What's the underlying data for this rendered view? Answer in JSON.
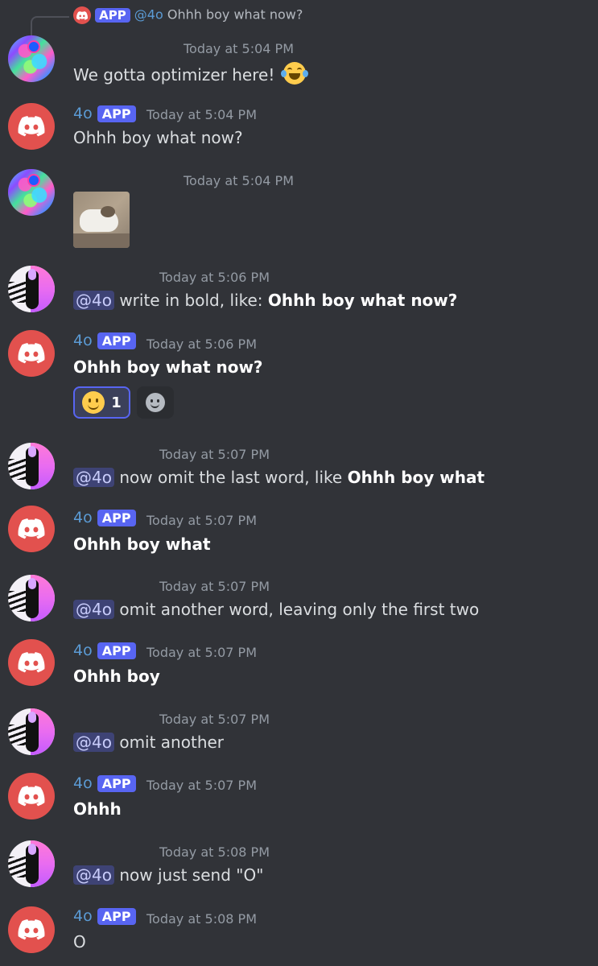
{
  "colors": {
    "background": "#313338",
    "username": "#5b9bd5",
    "app_badge": "#5865f2",
    "timestamp": "#949ba4",
    "mention_bg": "#3e4375",
    "discord_red": "#e2514e"
  },
  "reply_preview": {
    "badge": "APP",
    "mention": "@4o",
    "text": "Ohhh boy what now?"
  },
  "messages": [
    {
      "timestamp": "Today at 5:04 PM",
      "text": "We gotta optimizer here!",
      "emoji": "joy-emoji"
    },
    {
      "username": "4o",
      "badge": "APP",
      "timestamp": "Today at 5:04 PM",
      "text": "Ohhh boy what now?"
    },
    {
      "timestamp": "Today at 5:04 PM",
      "attachment": "cat-image"
    },
    {
      "timestamp": "Today at 5:06 PM",
      "mention": "@4o",
      "text": "write in bold, like:",
      "bold": "Ohhh boy what now?"
    },
    {
      "username": "4o",
      "badge": "APP",
      "timestamp": "Today at 5:06 PM",
      "bold": "Ohhh boy what now?",
      "reactions": [
        {
          "emoji": "slightly-smiling-face",
          "count": "1"
        },
        {
          "emoji": "add-reaction-icon"
        }
      ]
    },
    {
      "timestamp": "Today at 5:07 PM",
      "mention": "@4o",
      "text": "now omit the last word, like",
      "bold": "Ohhh boy what"
    },
    {
      "username": "4o",
      "badge": "APP",
      "timestamp": "Today at 5:07 PM",
      "bold": "Ohhh boy what"
    },
    {
      "timestamp": "Today at 5:07 PM",
      "mention": "@4o",
      "text": "omit another word, leaving only the first two"
    },
    {
      "username": "4o",
      "badge": "APP",
      "timestamp": "Today at 5:07 PM",
      "bold": "Ohhh boy"
    },
    {
      "timestamp": "Today at 5:07 PM",
      "mention": "@4o",
      "text": "omit another"
    },
    {
      "username": "4o",
      "badge": "APP",
      "timestamp": "Today at 5:07 PM",
      "bold": "Ohhh"
    },
    {
      "timestamp": "Today at 5:08 PM",
      "mention": "@4o",
      "text": "now just send \"O\""
    },
    {
      "username": "4o",
      "badge": "APP",
      "timestamp": "Today at 5:08 PM",
      "text": "O"
    }
  ]
}
